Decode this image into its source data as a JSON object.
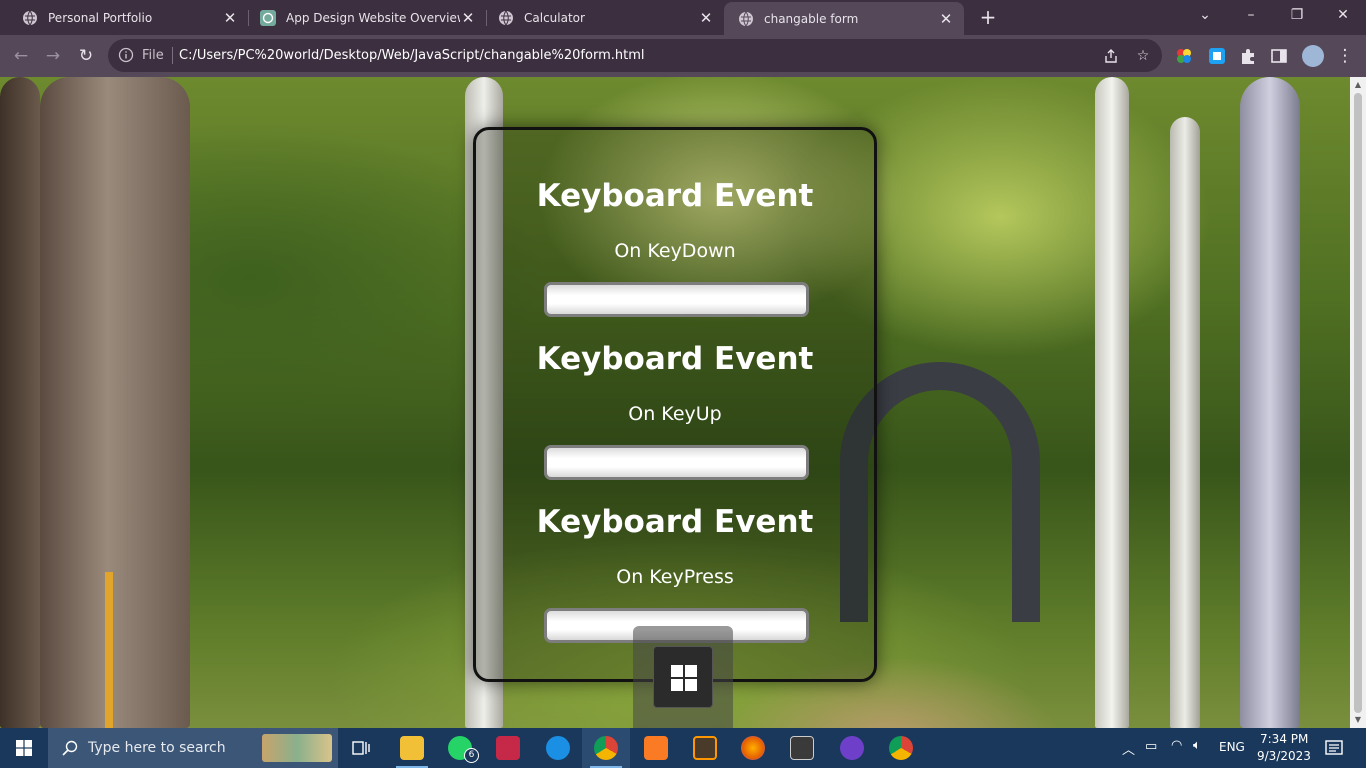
{
  "browser": {
    "tabs": [
      {
        "title": "Personal Portfolio",
        "active": false
      },
      {
        "title": "App Design Website Overview",
        "active": false
      },
      {
        "title": "Calculator",
        "active": false
      },
      {
        "title": "changable form",
        "active": true
      }
    ],
    "new_tab_label": "+",
    "window_controls": {
      "minimize": "–",
      "restore": "❐",
      "close": "✕",
      "tab_search": "⌄"
    },
    "toolbar": {
      "back": "←",
      "forward": "→",
      "reload": "↻",
      "scheme_label": "File",
      "url": "C:/Users/PC%20world/Desktop/Web/JavaScript/changable%20form.html",
      "share_icon": "share-icon",
      "bookmark": "☆"
    }
  },
  "page": {
    "sections": [
      {
        "title": "Keyboard Event",
        "subtitle": "On KeyDown",
        "value": ""
      },
      {
        "title": "Keyboard Event",
        "subtitle": "On KeyUp",
        "value": ""
      },
      {
        "title": "Keyboard Event",
        "subtitle": "On KeyPress",
        "value": ""
      }
    ]
  },
  "taskbar": {
    "search_placeholder": "Type here to search",
    "whatsapp_badge": "6",
    "language": "ENG",
    "time": "7:34 PM",
    "date": "9/3/2023"
  },
  "colors": {
    "tabstrip": "#3c2f3f",
    "toolbar": "#544859",
    "taskbar": "#19385b",
    "card_border": "#111111"
  }
}
